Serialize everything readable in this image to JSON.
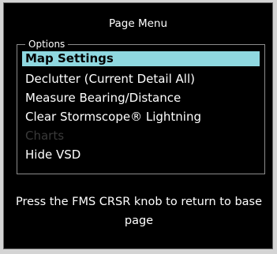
{
  "window": {
    "title": "Page Menu"
  },
  "options": {
    "legend": "Options",
    "items": [
      {
        "label": "Map Settings",
        "state": "selected"
      },
      {
        "label": "Declutter (Current Detail All)",
        "state": "normal"
      },
      {
        "label": "Measure Bearing/Distance",
        "state": "normal"
      },
      {
        "label": "Clear Stormscope® Lightning",
        "state": "normal"
      },
      {
        "label": "Charts",
        "state": "disabled"
      },
      {
        "label": "Hide VSD",
        "state": "normal"
      }
    ]
  },
  "footer": {
    "hint": "Press the FMS CRSR knob to return to base page"
  },
  "colors": {
    "background": "#000000",
    "text": "#ffffff",
    "selection": "#8fd8e0",
    "disabled_text": "#3a3a3a",
    "border": "#8c8c8c"
  }
}
